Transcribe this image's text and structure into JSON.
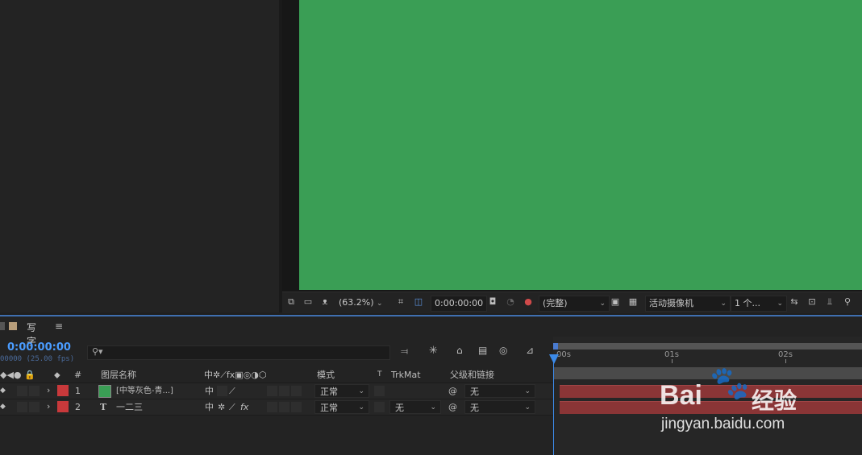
{
  "viewer_toolbar": {
    "zoom": "(63.2%)",
    "timecode": "0:00:00:00",
    "resolution": "(完整)",
    "camera": "活动摄像机",
    "views": "1 个..."
  },
  "timeline": {
    "tab_label": "写字",
    "menu_icon": "≡",
    "current_time": "0:00:00:00",
    "frame_info": "00000 (25.00 fps)",
    "search_placeholder": "",
    "columns": {
      "number": "#",
      "layer_name": "图层名称",
      "mode": "模式",
      "t": "T",
      "trkmat": "TrkMat",
      "parent": "父级和链接"
    },
    "ruler": [
      "00s",
      "01s",
      "02s"
    ],
    "layers": [
      {
        "num": "1",
        "name": "[中等灰色-青...]",
        "mode": "正常",
        "trkmat": "",
        "parent": "无",
        "label_color": "#c8393b",
        "type_icon": "solid"
      },
      {
        "num": "2",
        "name": "一二三",
        "type_glyph": "T",
        "mode": "正常",
        "trkmat": "无",
        "parent": "无",
        "label_color": "#c8393b",
        "type_icon": "text"
      }
    ]
  },
  "watermark": {
    "brand": "Bai",
    "brand_cn": "经验",
    "url": "jingyan.baidu.com"
  },
  "colors": {
    "canvas": "#3a9e55",
    "accent": "#3f6fb0",
    "layer_bar": "#8a3536"
  }
}
